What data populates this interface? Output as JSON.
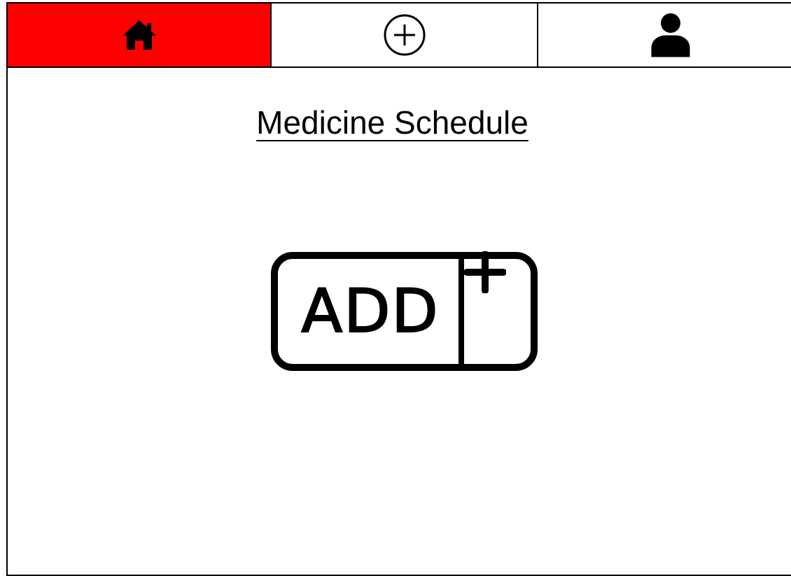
{
  "nav": {
    "tabs": [
      {
        "id": "home",
        "icon": "home-icon",
        "active": true
      },
      {
        "id": "add",
        "icon": "plus-circle-icon",
        "active": false
      },
      {
        "id": "profile",
        "icon": "user-icon",
        "active": false
      }
    ],
    "active_color": "#ff0000"
  },
  "page": {
    "title": "Medicine Schedule"
  },
  "add_button": {
    "label": "ADD",
    "icon": "plus-icon"
  }
}
